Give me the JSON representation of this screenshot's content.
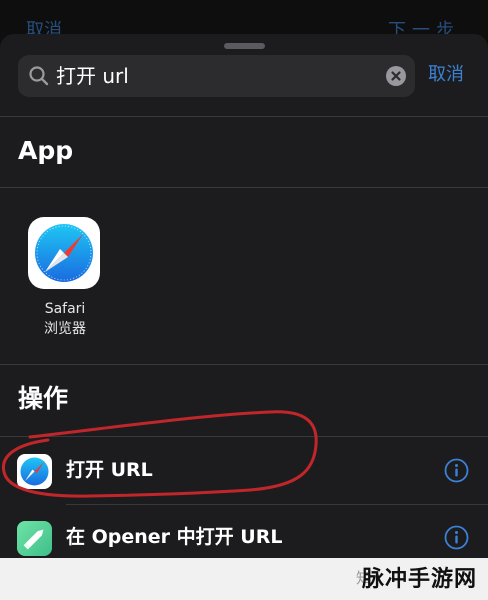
{
  "top_bar": {
    "left_label": "取消",
    "right_label": "下一步"
  },
  "search": {
    "query": "打开 url",
    "cancel_label": "取消"
  },
  "sections": {
    "apps_title": "App",
    "actions_title": "操作"
  },
  "apps": [
    {
      "name": "Safari",
      "subtitle": "浏览器",
      "icon": "safari-compass-icon"
    }
  ],
  "actions": [
    {
      "label": "打开 URL",
      "icon": "safari-compass-icon",
      "info_icon": "info-icon"
    },
    {
      "label": "在 Opener 中打开 URL",
      "icon": "opener-pencil-icon",
      "info_icon": "info-icon"
    }
  ],
  "colors": {
    "accent": "#3b82d6",
    "sheet": "#1c1c1e",
    "annotation_stroke": "#c0262a"
  },
  "watermark": {
    "left": "知",
    "right": "脉冲手游网"
  }
}
